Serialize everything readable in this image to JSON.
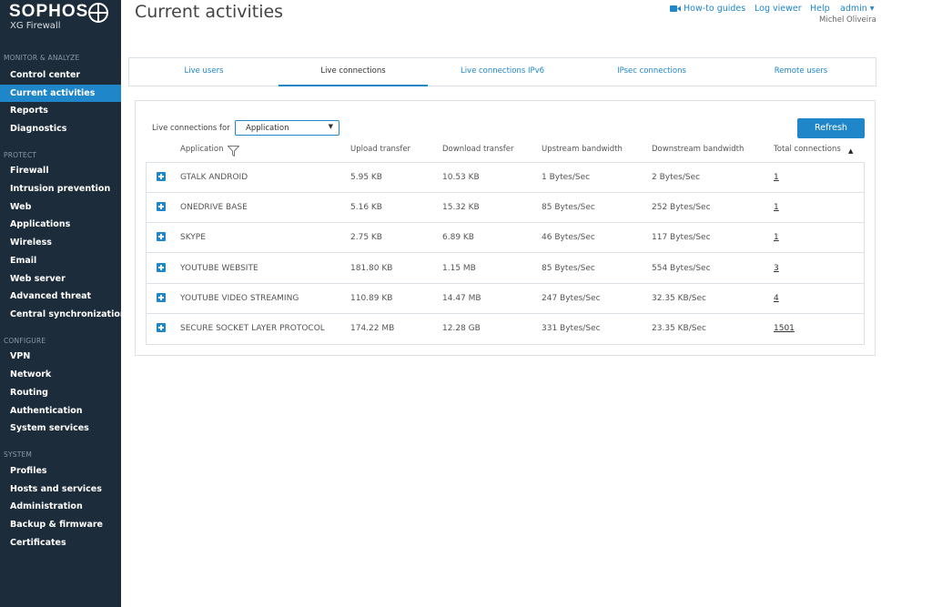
{
  "brand": {
    "name": "SOPHOS",
    "product": "XG Firewall"
  },
  "sidebar": {
    "sections": [
      {
        "title": "MONITOR & ANALYZE",
        "items": [
          "Control center",
          "Current activities",
          "Reports",
          "Diagnostics"
        ]
      },
      {
        "title": "PROTECT",
        "items": [
          "Firewall",
          "Intrusion prevention",
          "Web",
          "Applications",
          "Wireless",
          "Email",
          "Web server",
          "Advanced threat",
          "Central synchronization"
        ]
      },
      {
        "title": "CONFIGURE",
        "items": [
          "VPN",
          "Network",
          "Routing",
          "Authentication",
          "System services"
        ]
      },
      {
        "title": "SYSTEM",
        "items": [
          "Profiles",
          "Hosts and services",
          "Administration",
          "Backup & firmware",
          "Certificates"
        ]
      }
    ],
    "active_item": "Current activities"
  },
  "header": {
    "title": "Current activities",
    "links": {
      "howto": "How-to guides",
      "logviewer": "Log viewer",
      "help": "Help",
      "admin": "admin ▾"
    },
    "user": "Michel Oliveira"
  },
  "tabs": [
    "Live users",
    "Live connections",
    "Live connections IPv6",
    "IPsec connections",
    "Remote users"
  ],
  "active_tab": "Live connections",
  "controls": {
    "live_for_label": "Live connections for",
    "select_value": "Application",
    "refresh_label": "Refresh"
  },
  "table": {
    "columns": [
      "Application",
      "Upload transfer",
      "Download transfer",
      "Upstream bandwidth",
      "Downstream bandwidth",
      "Total connections"
    ],
    "rows": [
      {
        "app": "GTALK ANDROID",
        "upload": "5.95 KB",
        "download": "10.53 KB",
        "upstream": "1 Bytes/Sec",
        "downstream": "2 Bytes/Sec",
        "total": "1"
      },
      {
        "app": "ONEDRIVE BASE",
        "upload": "5.16 KB",
        "download": "15.32 KB",
        "upstream": "85 Bytes/Sec",
        "downstream": "252 Bytes/Sec",
        "total": "1"
      },
      {
        "app": "SKYPE",
        "upload": "2.75 KB",
        "download": "6.89 KB",
        "upstream": "46 Bytes/Sec",
        "downstream": "117 Bytes/Sec",
        "total": "1"
      },
      {
        "app": "YOUTUBE WEBSITE",
        "upload": "181.80 KB",
        "download": "1.15 MB",
        "upstream": "85 Bytes/Sec",
        "downstream": "554 Bytes/Sec",
        "total": "3"
      },
      {
        "app": "YOUTUBE VIDEO STREAMING",
        "upload": "110.89 KB",
        "download": "14.47 MB",
        "upstream": "247 Bytes/Sec",
        "downstream": "32.35 KB/Sec",
        "total": "4"
      },
      {
        "app": "SECURE SOCKET LAYER PROTOCOL",
        "upload": "174.22 MB",
        "download": "12.28 GB",
        "upstream": "331 Bytes/Sec",
        "downstream": "23.35 KB/Sec",
        "total": "1501"
      }
    ]
  },
  "colors": {
    "sidebar_bg": "#1c2c3a",
    "accent": "#1f86c9"
  },
  "icons": {
    "brand_logo": "sophos-shield-icon",
    "video": "video-camera-icon",
    "filter": "filter-icon",
    "sort": "sort-up-icon",
    "expand": "plus-square-icon"
  }
}
